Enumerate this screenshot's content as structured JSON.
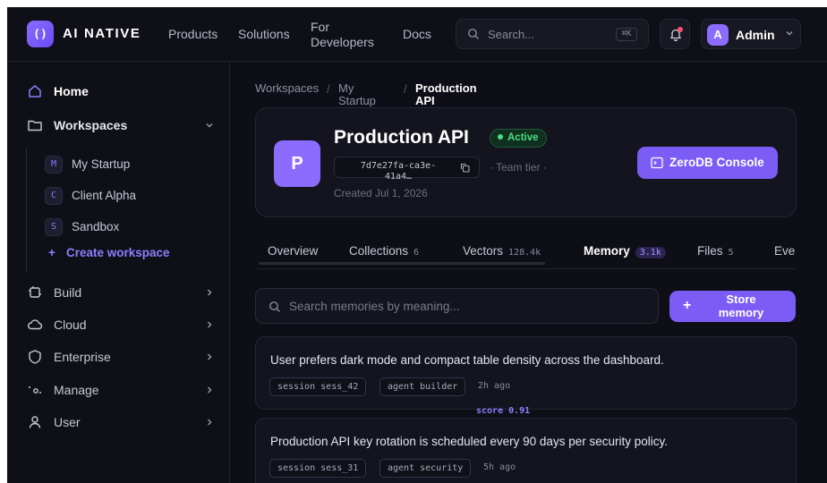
{
  "app": {
    "logo_mark": "()",
    "name": "AI NATIVE"
  },
  "nav": {
    "products": "Products",
    "solutions": "Solutions",
    "developers_line1": "For",
    "developers_line2": "Developers",
    "docs": "Docs"
  },
  "search": {
    "placeholder": "Search...",
    "shortcut": "⌘K"
  },
  "user": {
    "initial": "A",
    "name": "Admin"
  },
  "sidebar": {
    "home": "Home",
    "workspaces": "Workspaces",
    "workspace_items": [
      {
        "badge": "M",
        "label": "My Startup"
      },
      {
        "badge": "C",
        "label": "Client Alpha"
      },
      {
        "badge": "S",
        "label": "Sandbox"
      }
    ],
    "create": "Create workspace",
    "create_icon": "+",
    "build": "Build",
    "cloud": "Cloud",
    "enterprise": "Enterprise",
    "manage": "Manage",
    "user": "User"
  },
  "breadcrumb": {
    "root": "Workspaces",
    "sep": "/",
    "workspace_line1": "My",
    "workspace_line2": "Startup",
    "current_line1": "Production",
    "current_line2": "API"
  },
  "project": {
    "initial": "P",
    "title": "Production API",
    "status": "Active",
    "id_line1": "7d7e27fa-ca3e-",
    "id_line2": "41a4…",
    "tier": "· Team tier ·",
    "created": "Created Jul 1, 2026",
    "console_label": "ZeroDB Console"
  },
  "tabs": [
    {
      "label": "Overview",
      "count": ""
    },
    {
      "label": "Collections",
      "count": "6"
    },
    {
      "label": "Vectors",
      "count": "128.4k"
    },
    {
      "label": "Memory",
      "count": "3.1k"
    },
    {
      "label": "Files",
      "count": "5"
    },
    {
      "label": "Eve",
      "count": ""
    }
  ],
  "memory": {
    "search_placeholder": "Search memories by meaning...",
    "store_label": "Store memory",
    "store_icon": "+",
    "items": [
      {
        "text": "User prefers dark mode and compact table density across the dashboard.",
        "session": "session sess_42",
        "agent": "agent builder",
        "ago": "2h ago",
        "score": "score 0.91"
      },
      {
        "text": "Production API key rotation is scheduled every 90 days per security policy.",
        "session": "session sess_31",
        "agent": "agent security",
        "ago": "5h ago"
      }
    ]
  },
  "colors": {
    "accent": "#7b5cf5",
    "active": "#4ade80",
    "background": "#0e0e16"
  }
}
